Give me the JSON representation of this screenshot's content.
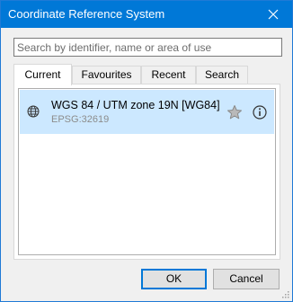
{
  "window": {
    "title": "Coordinate Reference System",
    "close_icon": "close-icon"
  },
  "search": {
    "placeholder": "Search by identifier, name or area of use",
    "value": ""
  },
  "tabs": [
    {
      "label": "Current",
      "active": true
    },
    {
      "label": "Favourites",
      "active": false
    },
    {
      "label": "Recent",
      "active": false
    },
    {
      "label": "Search",
      "active": false
    }
  ],
  "list": {
    "items": [
      {
        "name": "WGS 84 / UTM zone 19N [WG84]",
        "code": "EPSG:32619",
        "icon": "globe-icon",
        "selected": true,
        "favourite": false
      }
    ]
  },
  "buttons": {
    "ok_label": "OK",
    "cancel_label": "Cancel"
  },
  "colors": {
    "titlebar": "#0078d7",
    "selection": "#cce8ff",
    "default_button_border": "#0078d7"
  }
}
